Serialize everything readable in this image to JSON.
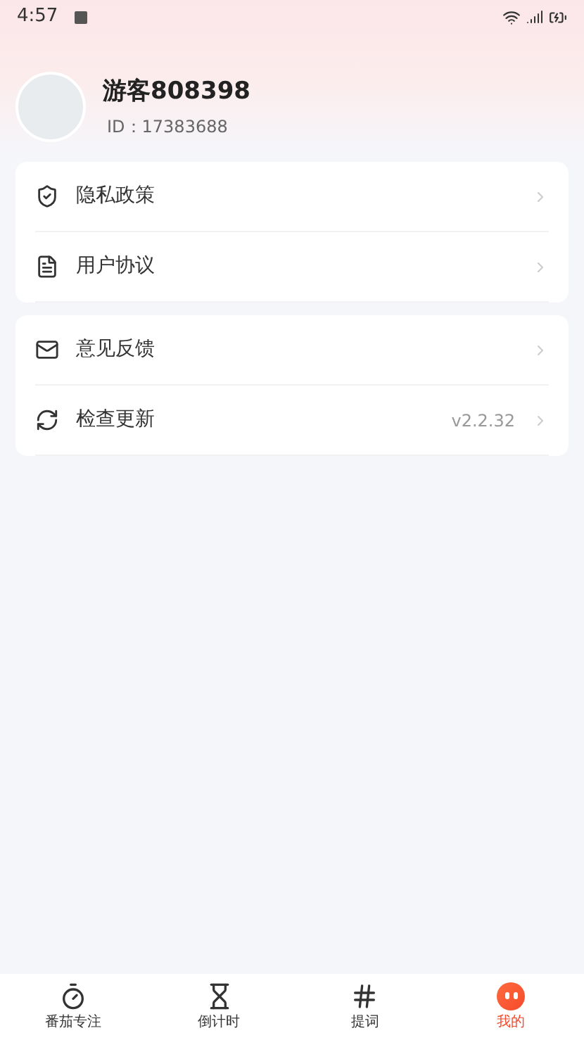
{
  "status_bar": {
    "time": "4:57"
  },
  "profile": {
    "name": "游客808398",
    "id": "ID：17383688"
  },
  "menu_groups": [
    {
      "items": [
        {
          "label": "隐私政策"
        },
        {
          "label": "用户协议"
        }
      ]
    },
    {
      "items": [
        {
          "label": "意见反馈"
        },
        {
          "label": "检查更新",
          "value": "v2.2.32"
        }
      ]
    }
  ],
  "tabs": [
    {
      "label": "番茄专注",
      "selected": false
    },
    {
      "label": "倒计时",
      "selected": false
    },
    {
      "label": "提词",
      "selected": false
    },
    {
      "label": "我的",
      "selected": true
    }
  ]
}
